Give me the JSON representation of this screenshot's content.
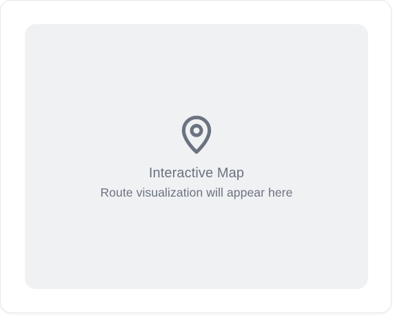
{
  "map": {
    "icon": "map-pin-icon",
    "title": "Interactive Map",
    "subtitle": "Route visualization will appear here"
  },
  "colors": {
    "placeholder_bg": "#f0f1f3",
    "text": "#6b7280",
    "icon": "#6b7280"
  }
}
